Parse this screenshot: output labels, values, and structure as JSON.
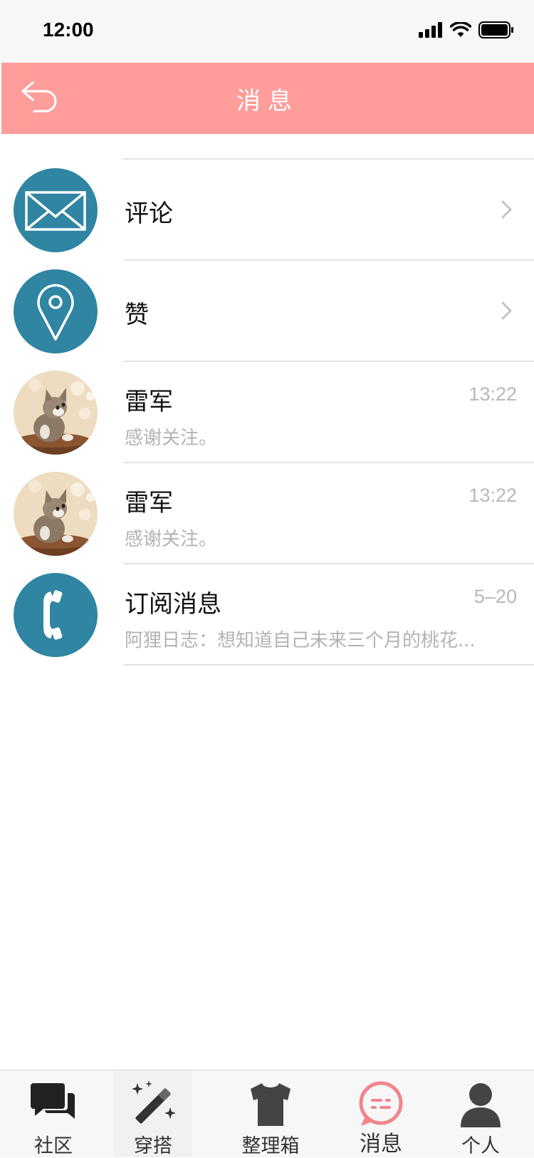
{
  "status_bar": {
    "time": "12:00"
  },
  "nav": {
    "title": "消息"
  },
  "messages": [
    {
      "name": "评论",
      "icon": "envelope-icon",
      "type": "category"
    },
    {
      "name": "赞",
      "icon": "location-pin-icon",
      "type": "category"
    },
    {
      "name": "雷军",
      "preview": "感谢关注。",
      "time": "13:22",
      "avatar": "cat-photo-avatar"
    },
    {
      "name": "雷军",
      "preview": "感谢关注。",
      "time": "13:22",
      "avatar": "cat-photo-avatar"
    },
    {
      "name": "订阅消息",
      "preview": "阿狸日志：想知道自己未来三个月的桃花...",
      "time": "5–20",
      "icon": "phone-icon"
    }
  ],
  "tabs": [
    {
      "label": "社区",
      "icon": "chat-bubbles-icon"
    },
    {
      "label": "穿搭",
      "icon": "magic-wand-icon"
    },
    {
      "label": "整理箱",
      "icon": "tshirt-icon"
    },
    {
      "label": "消息",
      "icon": "message-bubble-icon",
      "active": true
    },
    {
      "label": "个人",
      "icon": "person-icon"
    }
  ],
  "colors": {
    "accent": "#fe9d99",
    "icon_circle": "#2f85a2",
    "active_tab": "#f0858b"
  }
}
